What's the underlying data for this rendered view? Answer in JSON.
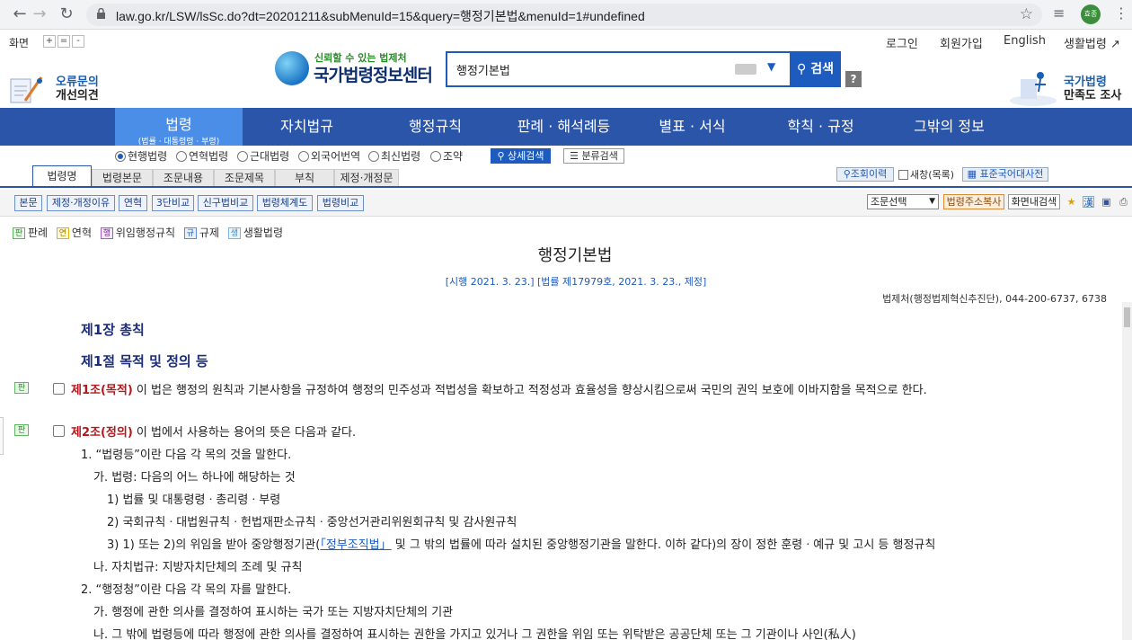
{
  "browser": {
    "url": "law.go.kr/LSW/lsSc.do?dt=20201211&subMenuId=15&query=행정기본법&menuId=1#undefined",
    "profile_label": "효종"
  },
  "util": {
    "screen_label": "화면",
    "zoom_in": "+",
    "zoom_reset": "=",
    "zoom_out": "-",
    "login": "로그인",
    "signup": "회원가입",
    "english": "English",
    "life_law": "생활법령"
  },
  "header": {
    "left_t1": "오류문의",
    "left_t2": "개선의견",
    "slogan": "신뢰할 수 있는 법제처",
    "logo_name": "국가법령정보센터",
    "search_value": "행정기본법",
    "search_button": "검색",
    "help": "?",
    "right_t1": "국가법령",
    "right_t2": "만족도 조사"
  },
  "mainnav": {
    "active_big": "법령",
    "active_small": "(법률 · 대통령령 · 부령)",
    "items": [
      "자치법규",
      "행정규칙",
      "판례 · 해석례등",
      "별표 · 서식",
      "학칙 · 규정",
      "그밖의 정보"
    ]
  },
  "radios": [
    "현행법령",
    "연혁법령",
    "근대법령",
    "외국어번역",
    "최신법령",
    "조약"
  ],
  "detail_search": "상세검색",
  "class_search": "분류검색",
  "tabs": [
    "법령명",
    "법령본문",
    "조문내용",
    "조문제목",
    "부칙",
    "제정·개정문"
  ],
  "lookup": "조회이력",
  "new_window": "새창(목록)",
  "dict": "표준국어대사전",
  "toolbar": {
    "buttons": [
      "본문",
      "제정·개정이유",
      "연혁",
      "3단비교",
      "신구법비교",
      "법령체계도",
      "법령비교"
    ],
    "select": "조문선택",
    "address_copy": "법령주소복사",
    "in_page_search": "화면내검색"
  },
  "legend": {
    "items": [
      {
        "badge": "판",
        "label": "판례"
      },
      {
        "badge": "연",
        "label": "연혁"
      },
      {
        "badge": "행",
        "label": "위임행정규칙"
      },
      {
        "badge": "규",
        "label": "규제"
      },
      {
        "badge": "생",
        "label": "생활법령"
      }
    ]
  },
  "doc": {
    "title": "행정기본법",
    "date": "[시행 2021. 3. 23.] [법률 제17979호, 2021. 3. 23., 제정]",
    "dept": "법제처(행정법제혁신추진단), 044-200-6737, 6738",
    "chapter": "제1장 총칙",
    "section": "제1절 목적 및 정의 등",
    "badge": "판",
    "art1_head": "제1조(목적)",
    "art1_body": " 이 법은 행정의 원칙과 기본사항을 규정하여 행정의 민주성과 적법성을 확보하고 적정성과 효율성을 향상시킴으로써 국민의 권익 보호에 이바지함을 목적으로 한다.",
    "art2_head": "제2조(정의)",
    "art2_body": " 이 법에서 사용하는 용어의 뜻은 다음과 같다.",
    "l1": "1. “법령등”이란 다음 각 목의 것을 말한다.",
    "l2": "가. 법령: 다음의 어느 하나에 해당하는 것",
    "l3": "1) 법률 및 대통령령ㆍ총리령ㆍ부령",
    "l4": "2) 국회규칙ㆍ대법원규칙ㆍ헌법재판소규칙ㆍ중앙선거관리위원회규칙 및 감사원규칙",
    "l5a": "3) 1) 또는 2)의 위임을 받아 중앙행정기관(",
    "l5link": "「정부조직법」",
    "l5b": " 및 그 밖의 법률에 따라 설치된 중앙행정기관을 말한다. 이하 같다)의 장이 정한 훈령ㆍ예규 및 고시 등 행정규칙",
    "l6": "나. 자치법규: 지방자치단체의 조례 및 규칙",
    "l7": "2. “행정청”이란 다음 각 목의 자를 말한다.",
    "l8": "가. 행정에 관한 의사를 결정하여 표시하는 국가 또는 지방자치단체의 기관",
    "l9": "나. 그 밖에 법령등에 따라 행정에 관한 의사를 결정하여 표시하는 권한을 가지고 있거나 그 권한을 위임 또는 위탁받은 공공단체 또는 그 기관이나 사인(私人)"
  },
  "colors": {
    "nav_blue": "#2a55a8",
    "nav_active": "#4a8ee8",
    "article_red": "#b3171b",
    "link_blue": "#1d5bbf"
  }
}
